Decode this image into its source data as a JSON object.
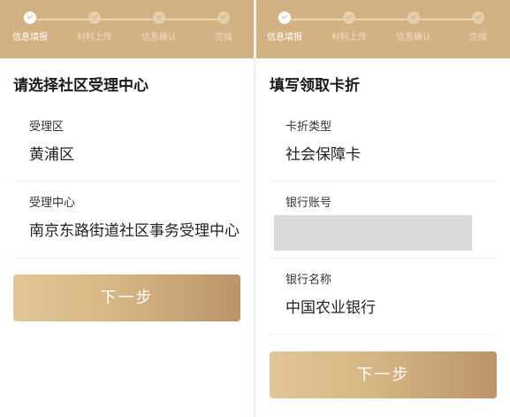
{
  "steps": [
    "信息填报",
    "材料上传",
    "信息确认",
    "完成"
  ],
  "left_panel": {
    "title": "请选择社区受理中心",
    "fields": [
      {
        "label": "受理区",
        "value": "黄浦区"
      },
      {
        "label": "受理中心",
        "value": "南京东路街道社区事务受理中心"
      }
    ],
    "next_label": "下一步"
  },
  "right_panel": {
    "title": "填写领取卡折",
    "fields": [
      {
        "label": "卡折类型",
        "value": "社会保障卡"
      },
      {
        "label": "银行账号",
        "value": ""
      },
      {
        "label": "银行名称",
        "value": "中国农业银行"
      }
    ],
    "next_label": "下一步"
  },
  "colors": {
    "step_bar": "#d2b283",
    "button_gradient_start": "#e2c697",
    "button_gradient_end": "#bb9469",
    "masked_field": "#d9d9d9"
  }
}
